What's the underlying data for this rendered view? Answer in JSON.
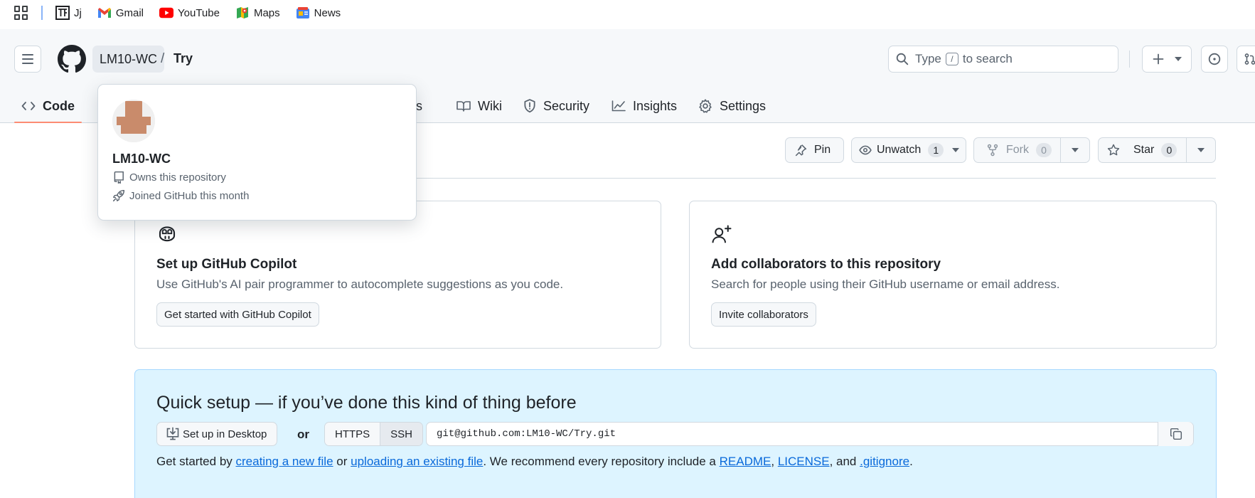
{
  "bookmarks": {
    "items": [
      {
        "label": "Jj",
        "icon": "tf-logo-icon"
      },
      {
        "label": "Gmail",
        "icon": "gmail-icon"
      },
      {
        "label": "YouTube",
        "icon": "youtube-icon"
      },
      {
        "label": "Maps",
        "icon": "maps-icon"
      },
      {
        "label": "News",
        "icon": "news-icon"
      }
    ]
  },
  "header": {
    "owner": "LM10-WC",
    "separator": "/",
    "repo": "Try",
    "search_prefix": "Type",
    "search_key": "/",
    "search_suffix": "to search"
  },
  "tabs": {
    "code": "Code",
    "projects_tail": "ects",
    "wiki": "Wiki",
    "security": "Security",
    "insights": "Insights",
    "settings": "Settings"
  },
  "actions": {
    "pin": "Pin",
    "unwatch": "Unwatch",
    "unwatch_count": "1",
    "fork": "Fork",
    "fork_count": "0",
    "star": "Star",
    "star_count": "0"
  },
  "hovercard": {
    "name": "LM10-WC",
    "owns": "Owns this repository",
    "joined": "Joined GitHub this month"
  },
  "copilot_card": {
    "title": "Set up GitHub Copilot",
    "description": "Use GitHub's AI pair programmer to autocomplete suggestions as you code.",
    "button": "Get started with GitHub Copilot"
  },
  "collab_card": {
    "title": "Add collaborators to this repository",
    "description": "Search for people using their GitHub username or email address.",
    "button": "Invite collaborators"
  },
  "quick_setup": {
    "title": "Quick setup — if you’ve done this kind of thing before",
    "desktop_button": "Set up in Desktop",
    "or": "or",
    "https": "HTTPS",
    "ssh": "SSH",
    "url": "git@github.com:LM10-WC/Try.git",
    "line_start": "Get started by",
    "link_new_file": "creating a new file",
    "line_or": "or",
    "link_upload": "uploading an existing file",
    "line_mid": ". We recommend every repository include a",
    "link_readme": "README",
    "comma1": ",",
    "link_license": "LICENSE",
    "line_and": ", and",
    "link_gitignore": ".gitignore",
    "period": "."
  },
  "colors": {
    "tab_underline": "#fd8c73",
    "link": "#0969da",
    "quick_setup_bg": "#ddf4ff",
    "avatar": "#c98b6b"
  }
}
